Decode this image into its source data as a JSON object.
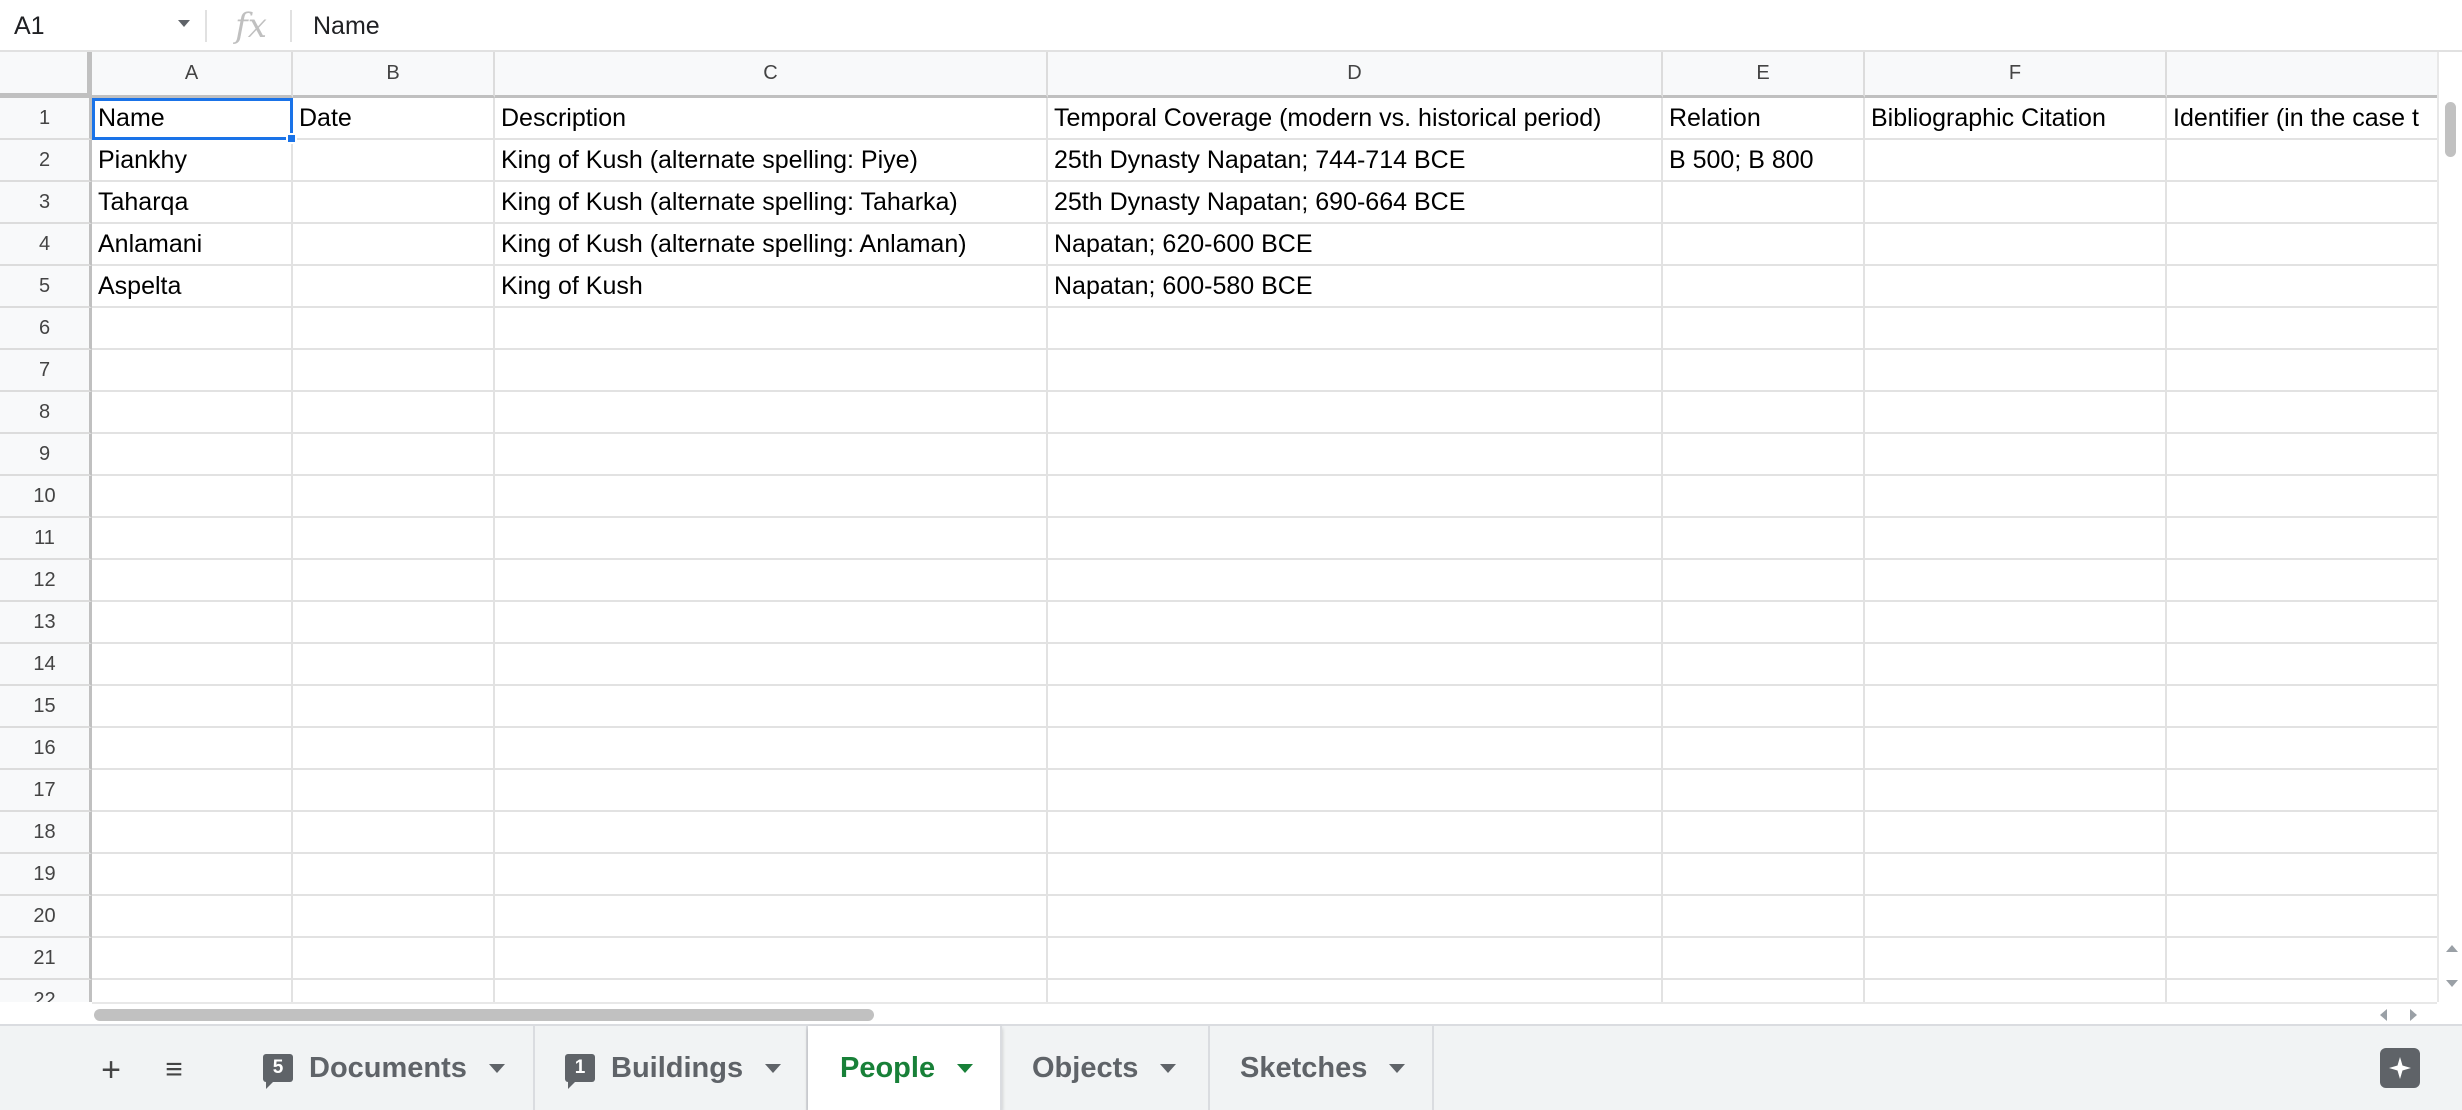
{
  "formula_bar": {
    "cell_ref": "A1",
    "fx_label": "fx",
    "value": "Name"
  },
  "columns": [
    "A",
    "B",
    "C",
    "D",
    "E",
    "F",
    ""
  ],
  "row_numbers": [
    "1",
    "2",
    "3",
    "4",
    "5",
    "6",
    "7",
    "8",
    "9",
    "10",
    "11",
    "12",
    "13",
    "14",
    "15",
    "16",
    "17",
    "18",
    "19",
    "20",
    "21",
    "22"
  ],
  "rows": [
    [
      "Name",
      "Date",
      "Description",
      "Temporal Coverage (modern vs. historical period)",
      "Relation",
      "Bibliographic Citation",
      "Identifier (in the case t"
    ],
    [
      "Piankhy",
      "",
      "King of Kush (alternate spelling: Piye)",
      "25th Dynasty Napatan; 744-714 BCE",
      "B 500; B 800",
      "",
      ""
    ],
    [
      "Taharqa",
      "",
      "King of Kush (alternate spelling: Taharka)",
      "25th Dynasty Napatan; 690-664 BCE",
      "",
      "",
      ""
    ],
    [
      "Anlamani",
      "",
      "King of Kush (alternate spelling: Anlaman)",
      "Napatan; 620-600 BCE",
      "",
      "",
      ""
    ],
    [
      "Aspelta",
      "",
      "King of Kush",
      "Napatan; 600-580 BCE",
      "",
      "",
      ""
    ]
  ],
  "sheet_tabs": [
    {
      "label": "Documents",
      "badge": "5",
      "active": false
    },
    {
      "label": "Buildings",
      "badge": "1",
      "active": false
    },
    {
      "label": "People",
      "badge": "",
      "active": true
    },
    {
      "label": "Objects",
      "badge": "",
      "active": false
    },
    {
      "label": "Sketches",
      "badge": "",
      "active": false
    }
  ],
  "tabbar_buttons": {
    "add_sheet": "+",
    "all_sheets": "≡"
  },
  "icons": {
    "add": "plus-icon",
    "all_sheets": "list-icon",
    "explore": "explore-icon",
    "name_box_dropdown": "caret-down-icon",
    "tab_menu": "caret-down-icon"
  },
  "colors": {
    "selection": "#1a73e8",
    "active_tab_text": "#188038",
    "header_bg": "#f8f9fa",
    "tabbar_bg": "#f1f3f4"
  }
}
